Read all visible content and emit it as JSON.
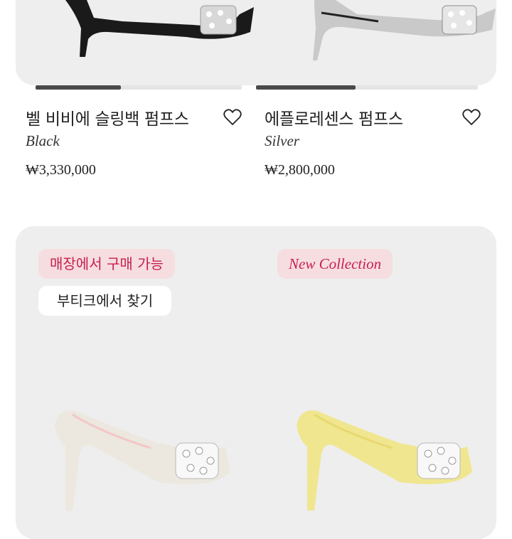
{
  "products": [
    {
      "name": "벨 비비에 슬링백 펌프스",
      "color": "Black",
      "price": "₩3,330,000"
    },
    {
      "name": "에플로레센스 펌프스",
      "color": "Silver",
      "price": "₩2,800,000"
    }
  ],
  "bottom_card": {
    "badge_store": "매장에서 구매 가능",
    "badge_find": "부티크에서 찾기",
    "badge_new": "New Collection"
  },
  "colors": {
    "accent": "#c8204e",
    "badge_bg": "#f6dde0",
    "card_bg": "#eeeeee",
    "shoe_black": "#1a1a1a",
    "shoe_silver": "#c9c9c9",
    "shoe_ivory": "#ece7df",
    "shoe_yellow": "#f0e690"
  },
  "icons": {
    "favorite": "heart-outline-icon"
  }
}
